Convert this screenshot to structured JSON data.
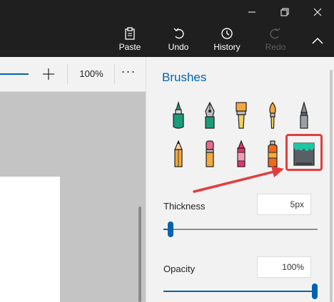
{
  "window_controls": {
    "minimize_icon": "minimize-icon",
    "restore_icon": "restore-icon",
    "close_icon": "close-icon"
  },
  "ribbon": {
    "paste_label": "Paste",
    "undo_label": "Undo",
    "history_label": "History",
    "redo_label": "Redo",
    "collapse_icon": "chevron-up-icon"
  },
  "zoom": {
    "value": "100%",
    "more": "···"
  },
  "panel": {
    "title": "Brushes",
    "brushes": [
      {
        "name": "marker",
        "icon": "marker-icon"
      },
      {
        "name": "calligraphy-pen",
        "icon": "calligraphy-pen-icon"
      },
      {
        "name": "flat-brush",
        "icon": "flat-brush-icon"
      },
      {
        "name": "oil-brush",
        "icon": "oil-brush-icon"
      },
      {
        "name": "technical-pen",
        "icon": "technical-pen-icon"
      },
      {
        "name": "pencil",
        "icon": "pencil-icon"
      },
      {
        "name": "eraser",
        "icon": "eraser-icon"
      },
      {
        "name": "crayon",
        "icon": "crayon-icon"
      },
      {
        "name": "spray-can",
        "icon": "spray-can-icon"
      },
      {
        "name": "pixel-pen",
        "icon": "pixel-pen-icon",
        "selected": true
      }
    ],
    "thickness_label": "Thickness",
    "thickness_value": "5px",
    "thickness_level": 0.03,
    "opacity_label": "Opacity",
    "opacity_value": "100%",
    "opacity_level": 1.0
  },
  "colors": {
    "accent": "#0063b1",
    "annotation": "#e33d3d"
  }
}
